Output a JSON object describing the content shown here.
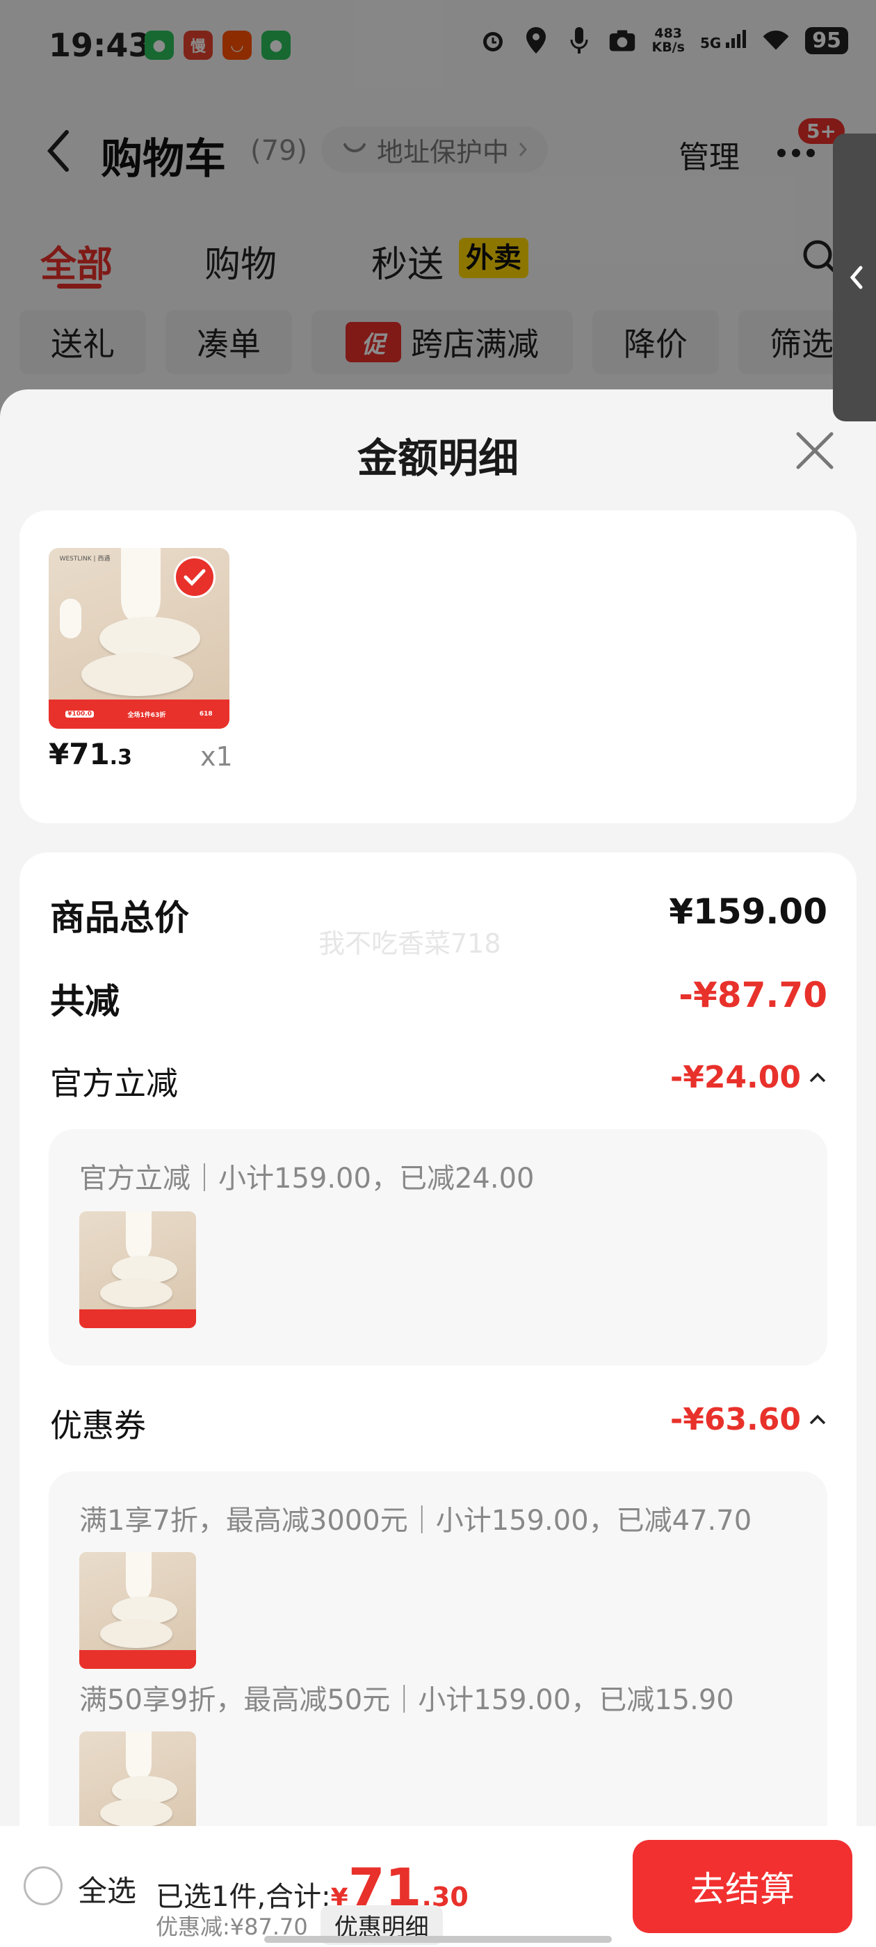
{
  "status_bar": {
    "time": "19:43",
    "net_speed_value": "483",
    "net_speed_unit": "KB/s",
    "signal": "5G",
    "battery": "95",
    "app_icon_slow": "慢"
  },
  "header": {
    "title": "购物车",
    "count": "(79)",
    "address": "地址保护中",
    "manage": "管理",
    "badge": "5+"
  },
  "tabs": [
    {
      "label": "全部",
      "active": true
    },
    {
      "label": "购物",
      "active": false
    },
    {
      "label": "秒送",
      "active": false,
      "tag": "外卖"
    }
  ],
  "filters": [
    "送礼",
    "凑单",
    "跨店满减",
    "降价",
    "筛选"
  ],
  "filters_promo_mark": "促",
  "sheet": {
    "title": "金额明细",
    "product": {
      "price_int": "¥71",
      "price_dec": ".3",
      "qty": "x1",
      "thumb_brand": "WESTLINK | 西遇",
      "thumb_tag_left": "¥100.0",
      "thumb_tag_mid": "全场1件63折",
      "thumb_tag_right": "618"
    },
    "watermark": "我不吃香菜718",
    "total_label": "商品总价",
    "total_value": "¥159.00",
    "reduce_label": "共减",
    "reduce_value": "-¥87.70",
    "official": {
      "label": "官方立减",
      "value": "-¥24.00",
      "detail": "官方立减｜小计159.00，已减24.00"
    },
    "coupon": {
      "label": "优惠券",
      "value": "-¥63.60",
      "details": [
        "满1享7折，最高减3000元｜小计159.00，已减47.70",
        "满50享9折，最高减50元｜小计159.00，已减15.90"
      ]
    }
  },
  "bottom_bar": {
    "select_all": "全选",
    "selected_prefix": "已选1件,合计:",
    "yen": "¥",
    "total_int": "71",
    "total_dec": ".30",
    "discount": "优惠减:¥87.70",
    "detail_button": "优惠明细",
    "checkout": "去结算"
  },
  "colors": {
    "accent_red": "#e8312b",
    "checkout_red": "#f23030",
    "waimai_yellow": "#ffd700"
  }
}
